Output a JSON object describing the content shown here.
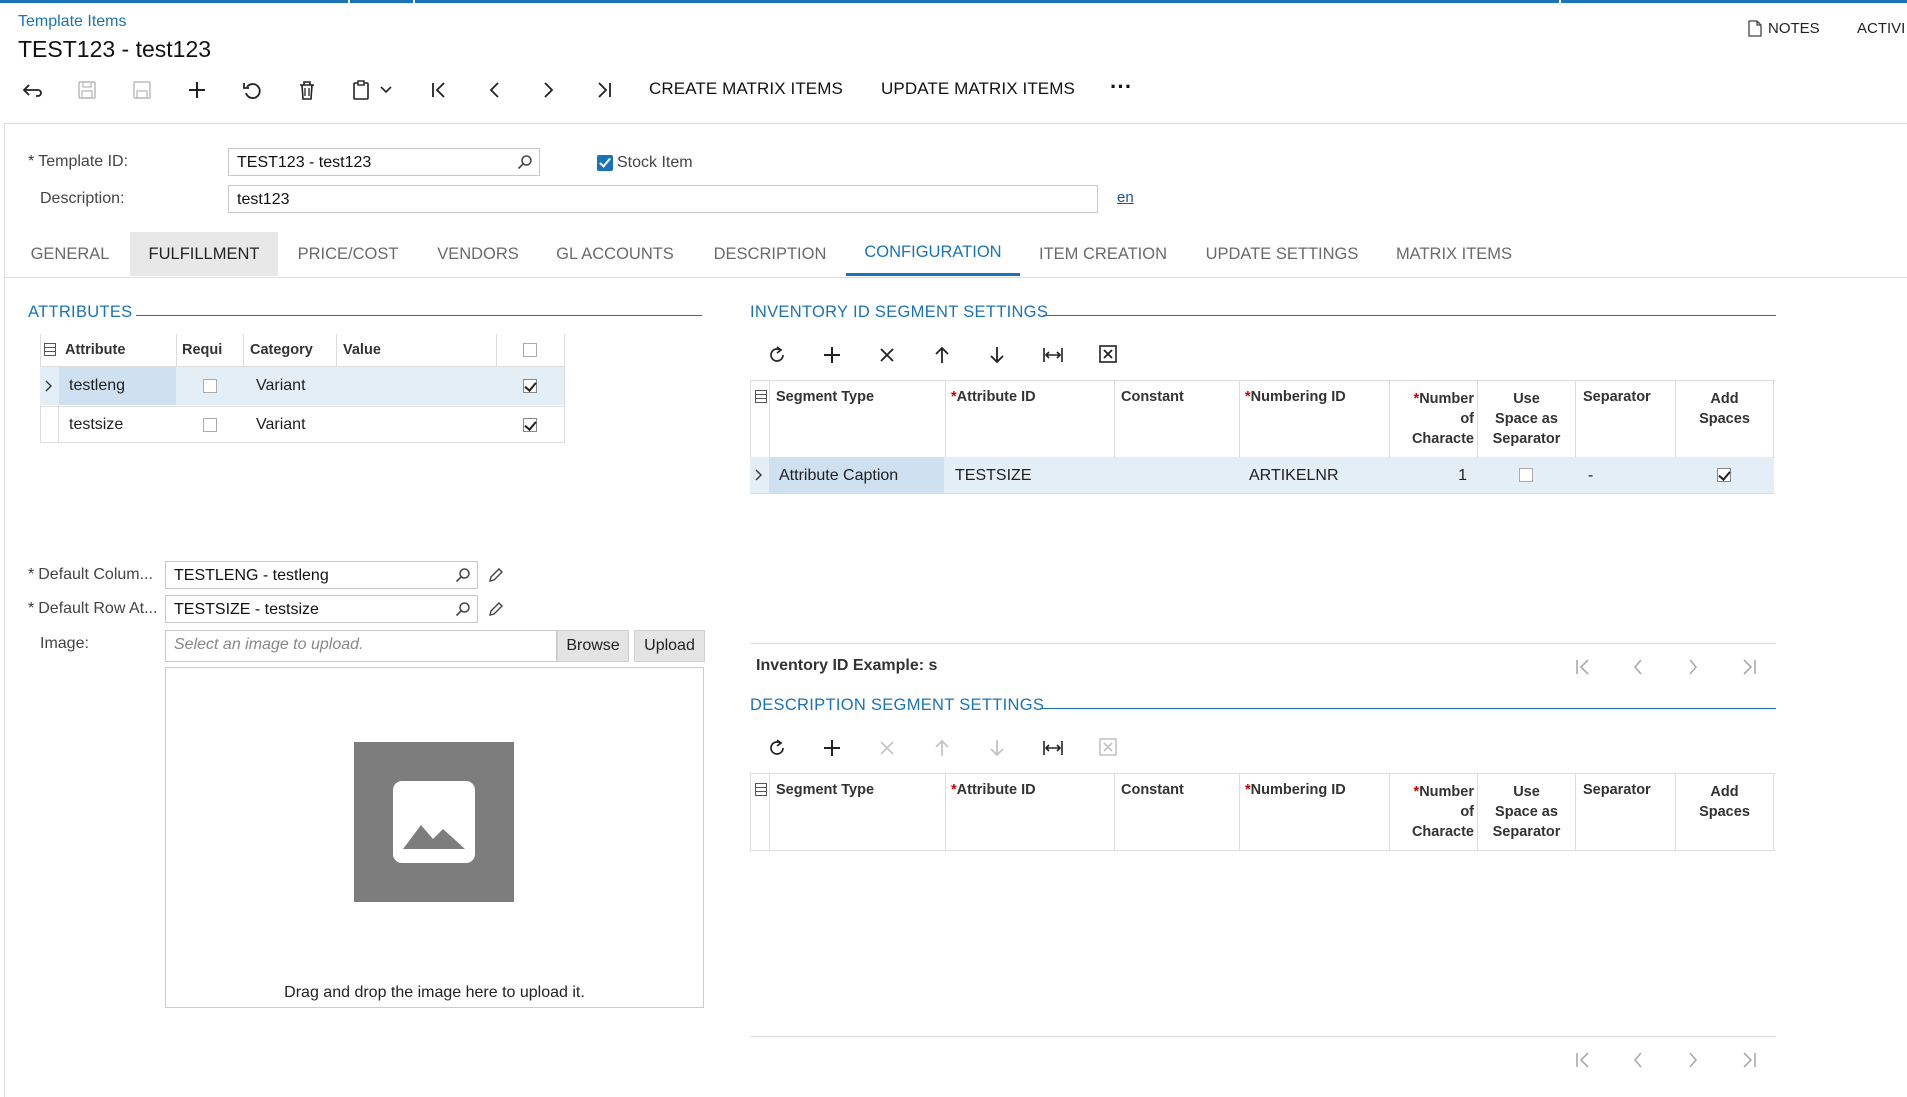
{
  "header": {
    "breadcrumb": "Template Items",
    "title": "TEST123 - test123",
    "notes_label": "NOTES",
    "activities_label": "ACTIVI"
  },
  "toolbar": {
    "create_matrix": "CREATE MATRIX ITEMS",
    "update_matrix": "UPDATE MATRIX ITEMS",
    "more": "···"
  },
  "form": {
    "template_id_label": "Template ID:",
    "template_id_value": "TEST123 - test123",
    "stock_item_label": "Stock Item",
    "description_label": "Description:",
    "description_value": "test123",
    "lang_link": "en"
  },
  "tabs": [
    "GENERAL",
    "FULFILLMENT",
    "PRICE/COST",
    "VENDORS",
    "GL ACCOUNTS",
    "DESCRIPTION",
    "CONFIGURATION",
    "ITEM CREATION",
    "UPDATE SETTINGS",
    "MATRIX ITEMS"
  ],
  "attributes": {
    "title": "ATTRIBUTES",
    "columns": [
      "Attribute",
      "Requi",
      "Category",
      "Value"
    ],
    "rows": [
      {
        "attribute": "testleng",
        "category": "Variant"
      },
      {
        "attribute": "testsize",
        "category": "Variant"
      }
    ]
  },
  "defaults": {
    "col_label": "Default Colum...",
    "col_value": "TESTLENG - testleng",
    "row_label": "Default Row At...",
    "row_value": "TESTSIZE - testsize",
    "image_label": "Image:",
    "image_placeholder": "Select an image to upload.",
    "browse": "Browse",
    "upload": "Upload",
    "drop_hint": "Drag and drop the image here to upload it."
  },
  "inventory_segments": {
    "title": "INVENTORY ID SEGMENT SETTINGS",
    "columns": {
      "segment_type": "Segment Type",
      "attribute_id": "Attribute ID",
      "constant": "Constant",
      "numbering_id": "Numbering ID",
      "number_chars_1": "Number",
      "number_chars_2": "of",
      "number_chars_3": "Characte",
      "use_space_1": "Use",
      "use_space_2": "Space as",
      "use_space_3": "Separator",
      "separator": "Separator",
      "add_spaces_1": "Add",
      "add_spaces_2": "Spaces"
    },
    "row": {
      "segment_type": "Attribute Caption",
      "attribute_id": "TESTSIZE",
      "numbering_id": "ARTIKELNR",
      "number_chars": "1",
      "separator": "-"
    },
    "example_label": "Inventory ID Example: s"
  },
  "description_segments": {
    "title": "DESCRIPTION SEGMENT SETTINGS"
  }
}
